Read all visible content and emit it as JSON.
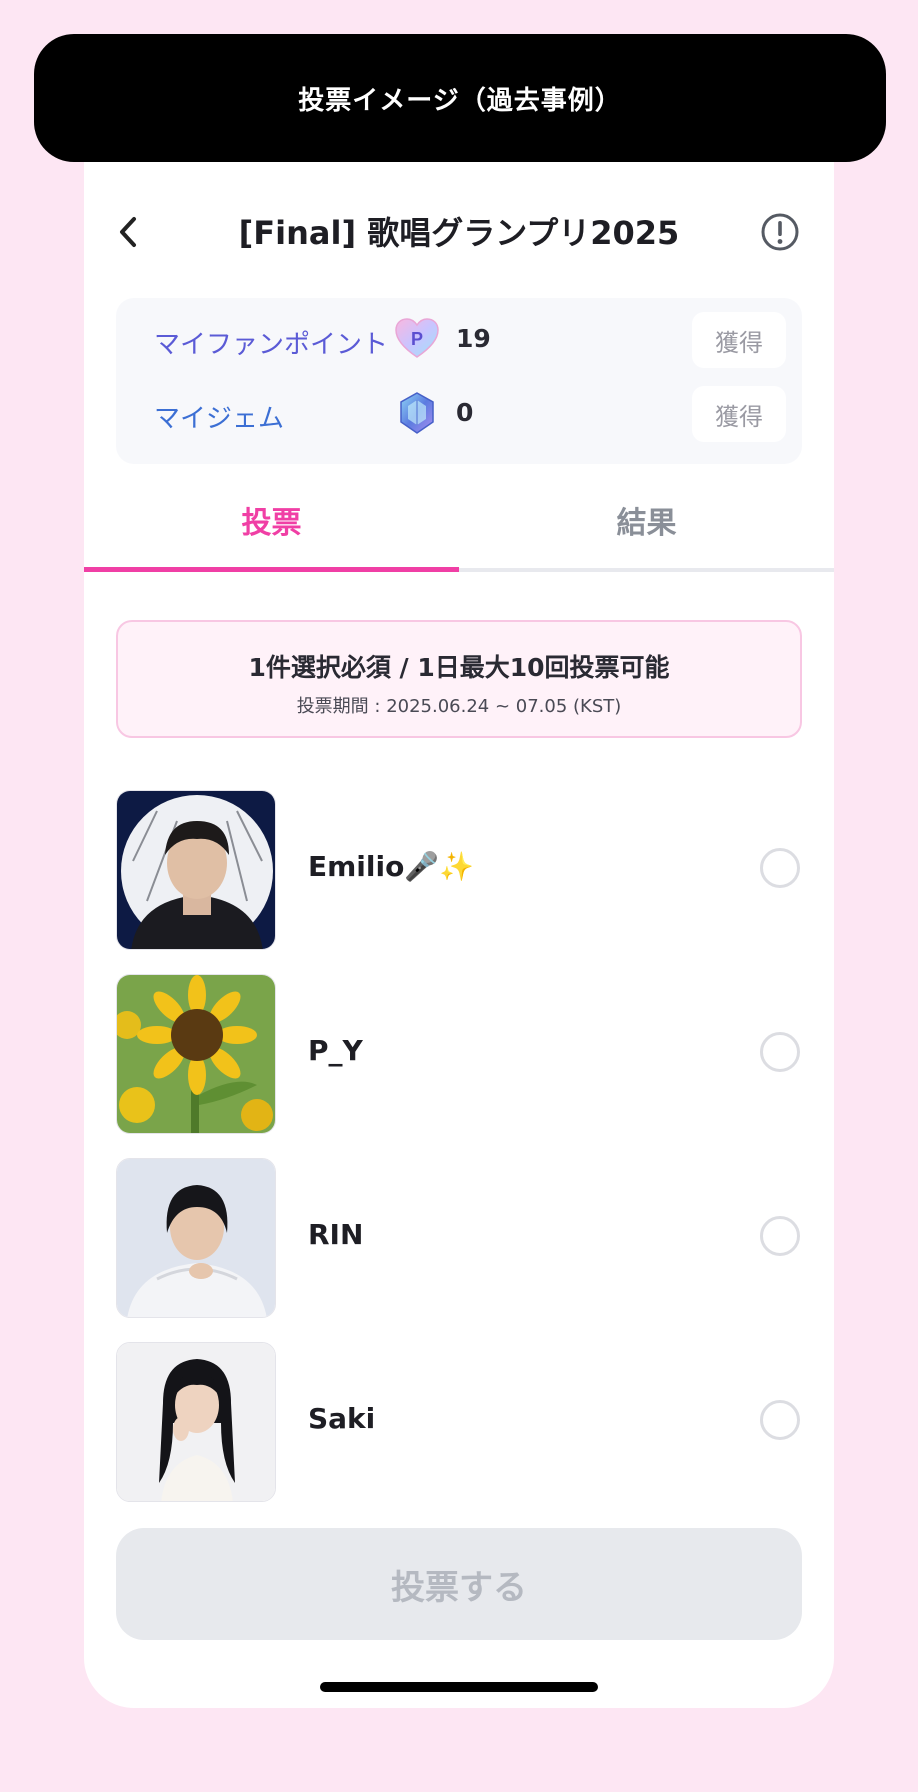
{
  "banner": {
    "text": "投票イメージ（過去事例）"
  },
  "header": {
    "title": "[Final] 歌唱グランプリ2025"
  },
  "points": {
    "fan_label": "マイファンポイント",
    "fan_icon_letter": "P",
    "fan_value": "19",
    "gem_label": "マイジェム",
    "gem_value": "0",
    "earn_label": "獲得"
  },
  "tabs": {
    "vote": "投票",
    "result": "結果"
  },
  "notice": {
    "main": "1件選択必須 / 1日最大10回投票可能",
    "period": "投票期間 : 2025.06.24 ~ 07.05 (KST)"
  },
  "candidates": [
    {
      "name": "Emilio🎤✨"
    },
    {
      "name": "P_Y"
    },
    {
      "name": "RIN"
    },
    {
      "name": "Saki"
    }
  ],
  "vote_button": "投票する",
  "colors": {
    "accent": "#f03fa5",
    "banner": "#000000",
    "background": "#fde6f3"
  }
}
